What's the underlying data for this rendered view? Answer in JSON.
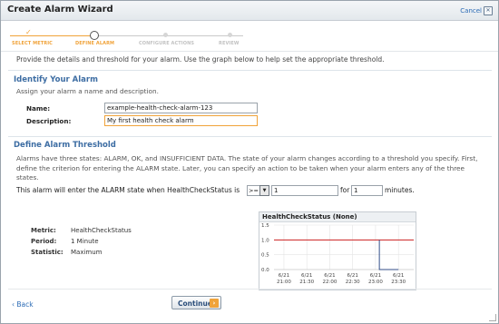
{
  "dialog": {
    "title": "Create Alarm Wizard",
    "cancel_label": "Cancel"
  },
  "steps": [
    {
      "label": "Select Metric",
      "state": "done"
    },
    {
      "label": "Define Alarm",
      "state": "current"
    },
    {
      "label": "Configure Actions",
      "state": "future"
    },
    {
      "label": "Review",
      "state": "future"
    }
  ],
  "intro": "Provide the details and threshold for your alarm. Use the graph below to help set the appropriate threshold.",
  "identify": {
    "title": "Identify Your Alarm",
    "subtitle": "Assign your alarm a name and description.",
    "name_label": "Name:",
    "name_value": "example-health-check-alarm-123",
    "description_label": "Description:",
    "description_value": "My first health check alarm"
  },
  "threshold": {
    "title": "Define Alarm Threshold",
    "description": "Alarms have three states: ALARM, OK, and INSUFFICIENT DATA. The state of your alarm changes according to a threshold you specify. First, define the criterion for entering the ALARM state. Later, you can specify an action to be taken when your alarm enters any of the three states.",
    "condition_prefix": "This alarm will enter the ALARM state when HealthCheckStatus is",
    "operator": ">=",
    "threshold_value": "1",
    "for_label": "for",
    "periods_value": "1",
    "minutes_label": "minutes."
  },
  "stats": {
    "metric_label": "Metric:",
    "metric_value": "HealthCheckStatus",
    "period_label": "Period:",
    "period_value": "1 Minute",
    "statistic_label": "Statistic:",
    "statistic_value": "Maximum"
  },
  "chart_data": {
    "type": "line",
    "title": "HealthCheckStatus (None)",
    "y_ticks": [
      "1.5",
      "1.0",
      "0.5",
      "0.0"
    ],
    "ylim": [
      0,
      1.5
    ],
    "x_ticks": [
      {
        "date": "6/21",
        "time": "21:00"
      },
      {
        "date": "6/21",
        "time": "21:30"
      },
      {
        "date": "6/21",
        "time": "22:00"
      },
      {
        "date": "6/21",
        "time": "22:30"
      },
      {
        "date": "6/21",
        "time": "23:00"
      },
      {
        "date": "6/21",
        "time": "23:30"
      }
    ],
    "threshold": 1.0,
    "threshold_color": "#cc2222",
    "series": [
      {
        "x": [
          "23:05",
          "23:05",
          "23:30"
        ],
        "values": [
          1.0,
          0.0,
          0.0
        ],
        "color": "#334f8a"
      }
    ]
  },
  "footer": {
    "back_label": "Back",
    "continue_label": "Continue"
  },
  "colors": {
    "accent": "#f0a33a",
    "link": "#2b6bb5",
    "section_title": "#3d6da3"
  }
}
